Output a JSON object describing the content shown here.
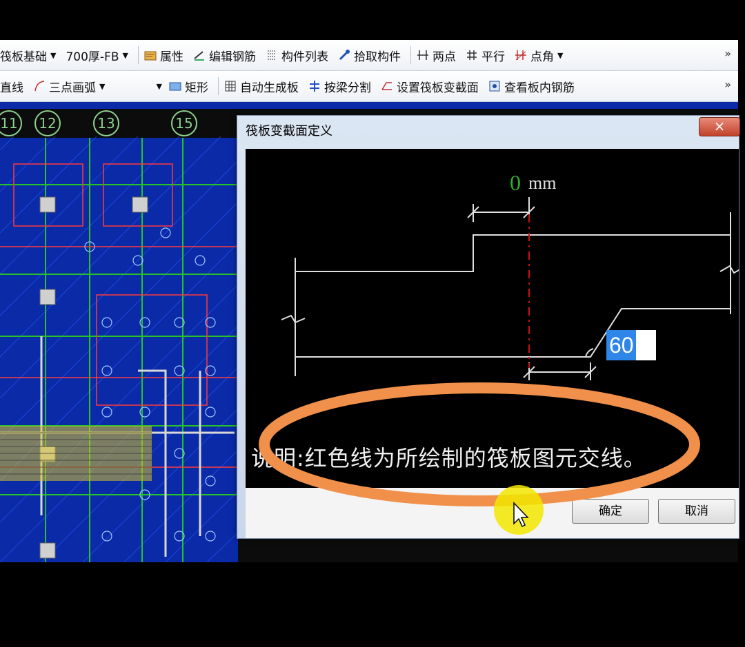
{
  "toolbar1": {
    "items": [
      {
        "label": "筏板基础",
        "dropdown": true
      },
      {
        "label": "700厚-FB",
        "dropdown": true
      },
      {
        "label": "属性"
      },
      {
        "label": "编辑钢筋"
      },
      {
        "label": "构件列表"
      },
      {
        "label": "拾取构件"
      },
      {
        "label": "两点"
      },
      {
        "label": "平行"
      },
      {
        "label": "点角",
        "dropdown": true
      }
    ],
    "more": "»"
  },
  "toolbar2": {
    "items": [
      {
        "label": "直线"
      },
      {
        "label": "三点画弧",
        "dropdown": true
      },
      {
        "label": "矩形"
      },
      {
        "label": "自动生成板"
      },
      {
        "label": "按梁分割"
      },
      {
        "label": "设置筏板变截面"
      },
      {
        "label": "查看板内钢筋"
      }
    ],
    "more": "»"
  },
  "axes": [
    "11",
    "12",
    "13",
    "15"
  ],
  "dialog": {
    "title": "筏板变截面定义",
    "close": "×",
    "offset_value": "0",
    "offset_unit": "mm",
    "angle_value": "60",
    "note": "说明:红色线为所绘制的筏板图元交线。",
    "ok": "确定",
    "cancel": "取消"
  },
  "colors": {
    "canvas_blue": "#0a2aa8",
    "dimension_green": "#2fb12f",
    "red_line": "#d01010",
    "annotation_orange": "#f0904a",
    "highlight_yellow": "#f2e600"
  }
}
